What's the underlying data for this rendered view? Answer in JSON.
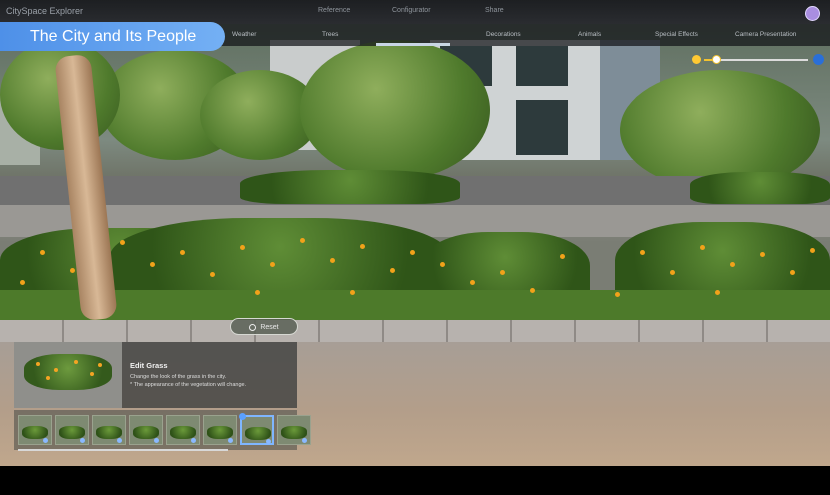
{
  "topbar": {
    "brand": "CitySpace Explorer",
    "tabs": [
      "Reference",
      "Configurator",
      "Share"
    ]
  },
  "title": "The City and Its People",
  "subnav": {
    "tabs": [
      "Weather",
      "Trees",
      "Decorations",
      "Animals",
      "Special Effects",
      "Camera Presentation"
    ],
    "selected_index": 2
  },
  "time_slider": {
    "value": 0.12,
    "start_icon": "sun-icon",
    "end_icon": "moon-icon",
    "accent_color": "#f2c230"
  },
  "reset_label": "Reset",
  "edit_panel": {
    "title": "Edit Grass",
    "description": [
      "Change the look of the grass in the city.",
      "* The appearance of the vegetation will change."
    ]
  },
  "grass_options": {
    "count": 8,
    "selected_index": 6
  },
  "colors": {
    "title_pill": "#5b9cee",
    "selection": "#7fb6ff"
  }
}
